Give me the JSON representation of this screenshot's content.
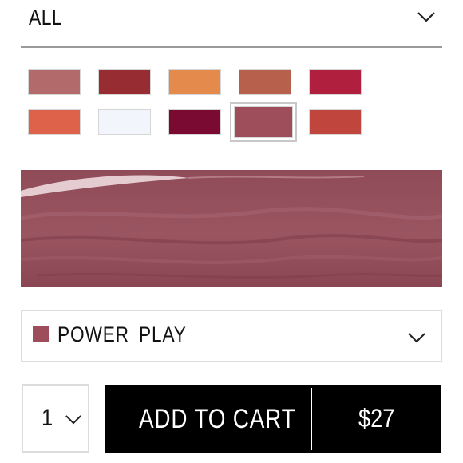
{
  "filter": {
    "label": "ALL",
    "icon": "chevron-down-icon"
  },
  "swatches": [
    {
      "name": "swatch-1",
      "color": "#b36a6a"
    },
    {
      "name": "swatch-2",
      "color": "#972c33"
    },
    {
      "name": "swatch-3",
      "color": "#e38a4c"
    },
    {
      "name": "swatch-4",
      "color": "#b7614c"
    },
    {
      "name": "swatch-5",
      "color": "#b11f3e"
    },
    {
      "name": "swatch-6",
      "color": "#de6249"
    },
    {
      "name": "swatch-7",
      "color": "#f2f6fc"
    },
    {
      "name": "swatch-8",
      "color": "#7b0a33"
    },
    {
      "name": "swatch-9",
      "color": "#9e4e5b",
      "selected": true
    },
    {
      "name": "swatch-10",
      "color": "#c0463d"
    }
  ],
  "preview": {
    "color": "#8f4b57"
  },
  "shade": {
    "name": "POWER PLAY",
    "color": "#9e4e5b",
    "icon": "chevron-down-icon"
  },
  "quantity": {
    "value": "1",
    "icon": "chevron-down-icon"
  },
  "add_to_cart": {
    "label": "ADD TO CART",
    "price": "$27"
  }
}
